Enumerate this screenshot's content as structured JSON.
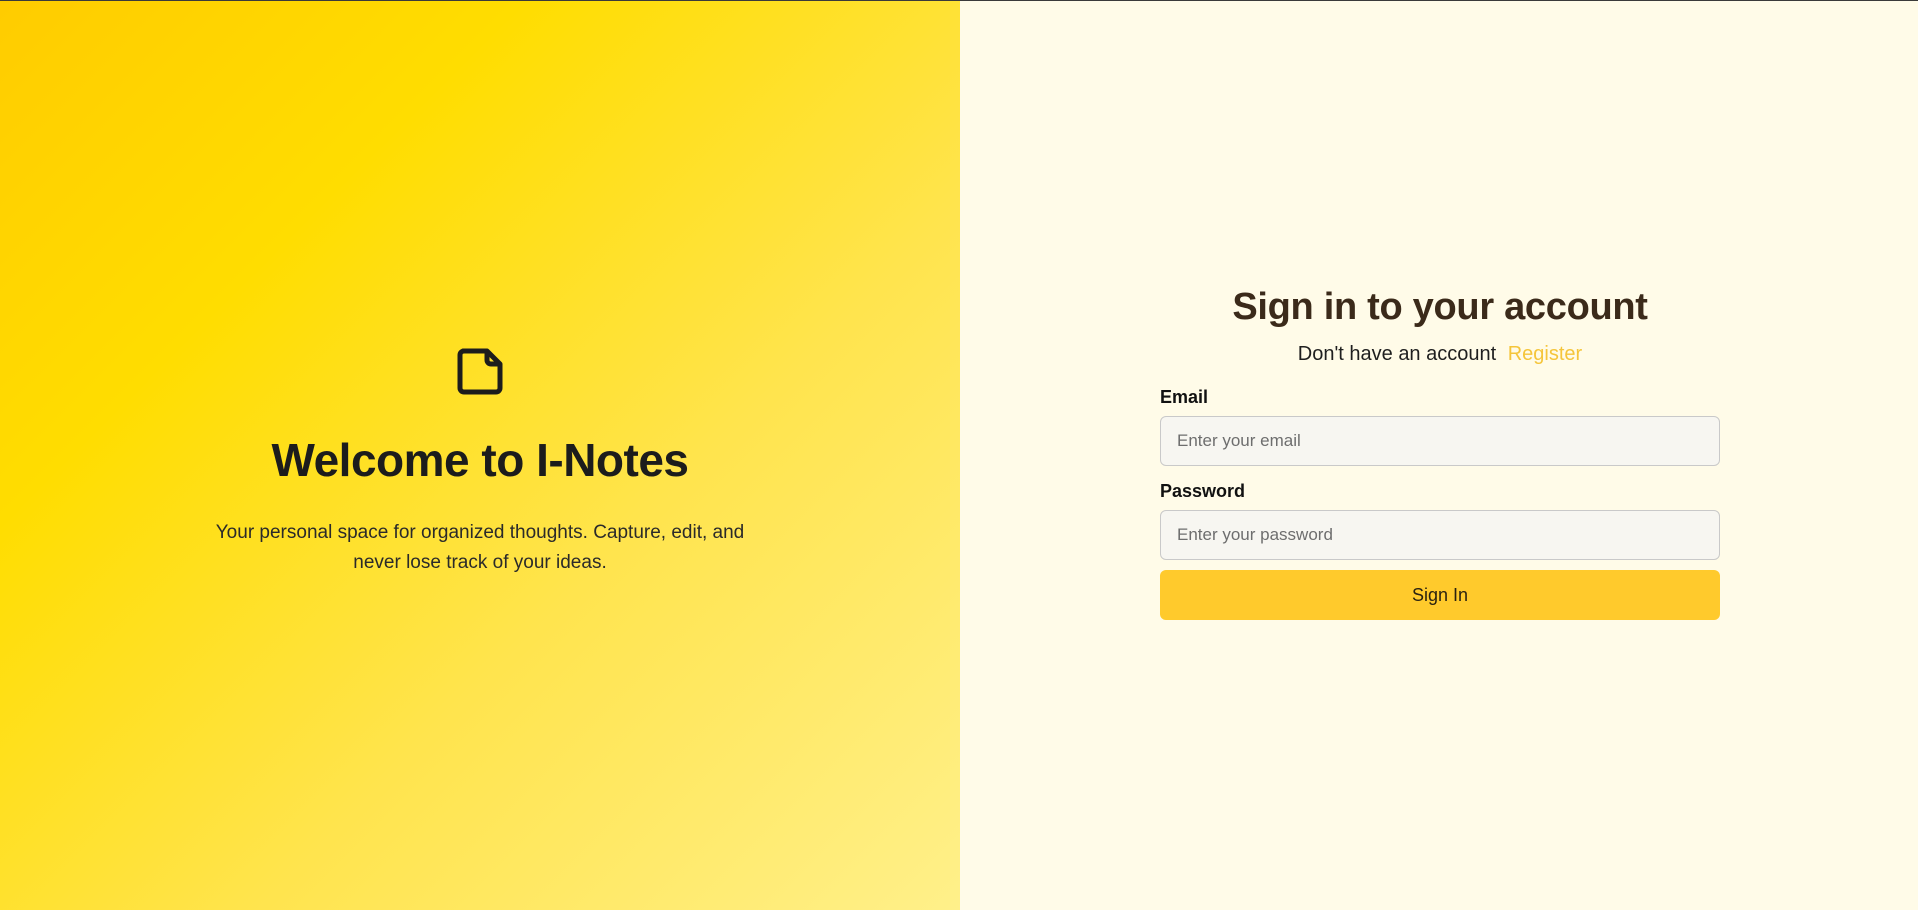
{
  "hero": {
    "icon": "note-icon",
    "title": "Welcome to I-Notes",
    "subtitle": "Your personal space for organized thoughts. Capture, edit, and never lose track of your ideas."
  },
  "auth": {
    "title": "Sign in to your account",
    "prompt": "Don't have an account",
    "register_link": "Register",
    "email": {
      "label": "Email",
      "value": "",
      "placeholder": "Enter your email"
    },
    "password": {
      "label": "Password",
      "value": "",
      "placeholder": "Enter your password"
    },
    "submit_label": "Sign In"
  },
  "colors": {
    "accent": "#FFCA2C",
    "link": "#F5C53A",
    "hero_gradient_start": "#FFCC00",
    "hero_gradient_end": "#FFF08A",
    "panel_background": "#FFFBE8",
    "heading": "#3b2a1a"
  }
}
